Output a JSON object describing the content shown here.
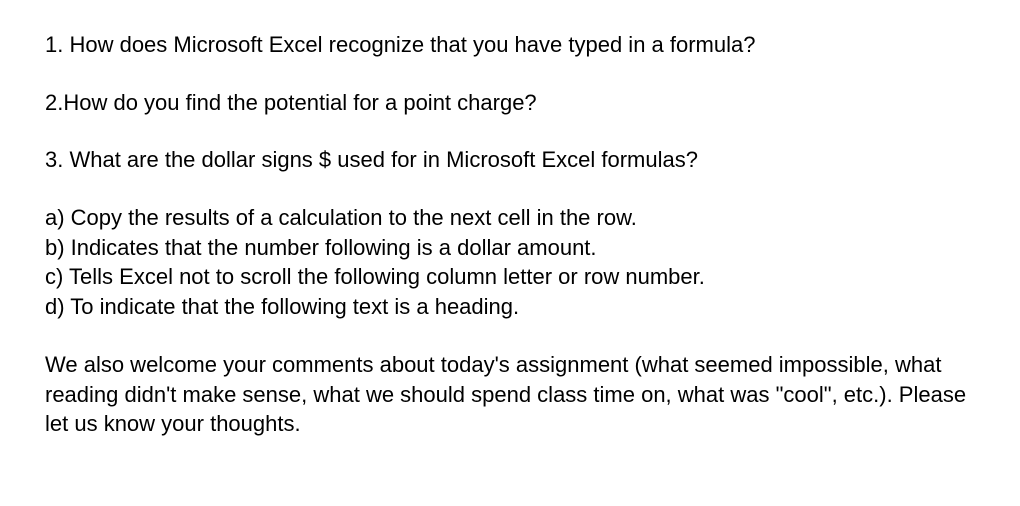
{
  "questions": {
    "q1": "1. How does Microsoft Excel recognize that you have typed in a formula?",
    "q2": "2.How do you find the potential for a point charge?",
    "q3": "3. What are the dollar signs $ used for in Microsoft Excel formulas?"
  },
  "options": {
    "a": "a) Copy the results of a calculation to the next cell in the row.",
    "b": "b) Indicates that the number following is a dollar amount.",
    "c": "c) Tells Excel not to scroll the following column letter or row number.",
    "d": "d) To indicate that the following text is a heading."
  },
  "comments": "We also welcome your comments about today's assignment (what seemed impossible, what reading didn't make sense, what we should spend class time on, what was \"cool\", etc.). Please let us know your thoughts."
}
